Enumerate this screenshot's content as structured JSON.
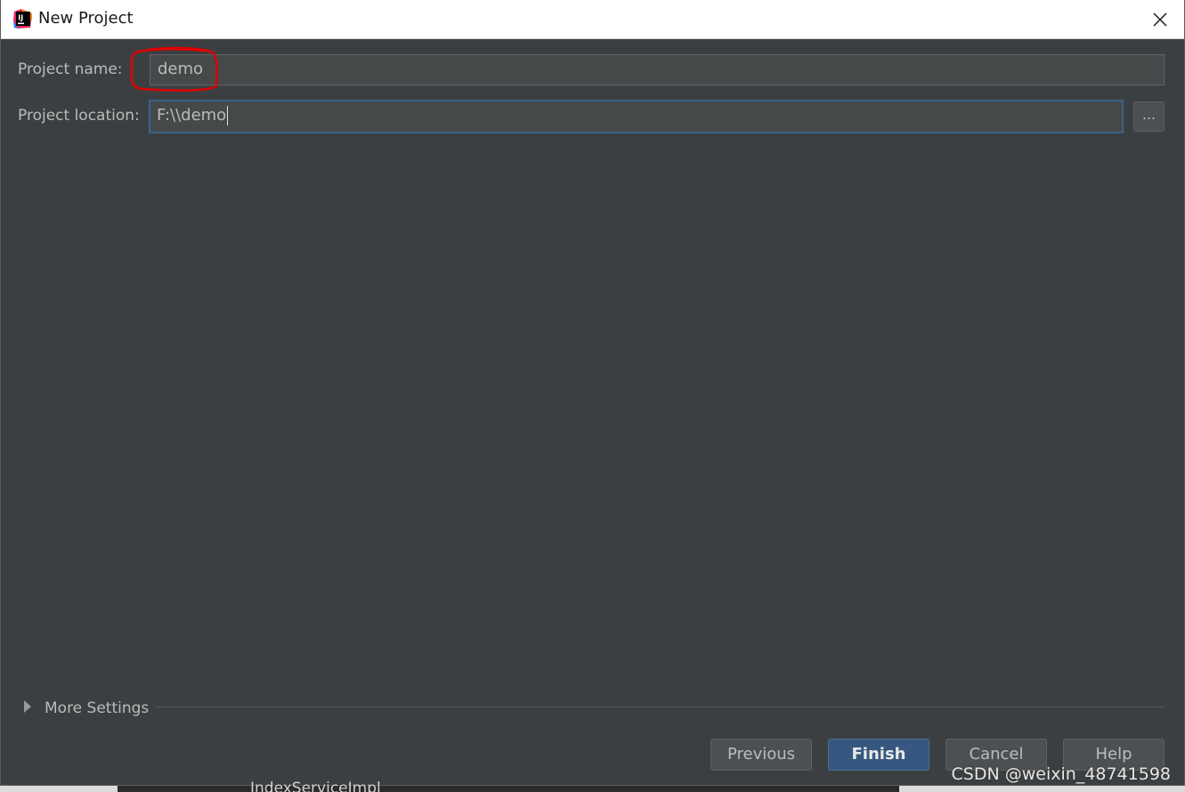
{
  "window": {
    "title": "New Project"
  },
  "form": {
    "project_name_label": "Project name:",
    "project_name_value": "demo",
    "project_location_label": "Project location:",
    "project_location_value": "F:\\\\demo",
    "browse_label": "..."
  },
  "more_settings": {
    "label": "More Settings"
  },
  "buttons": {
    "previous": "Previous",
    "finish": "Finish",
    "cancel": "Cancel",
    "help": "Help"
  },
  "background": {
    "taskbar_text": "IndexServiceImpl"
  },
  "watermark": {
    "text": "CSDN @weixin_48741598"
  },
  "colors": {
    "dialog_bg": "#3c3f41",
    "field_bg": "#45494a",
    "focus_border": "#3d6185",
    "primary_button": "#365880",
    "annotation_red": "#e00000"
  },
  "icons": {
    "app": "intellij-idea-icon",
    "close": "close-icon",
    "expand": "triangle-right-icon"
  }
}
